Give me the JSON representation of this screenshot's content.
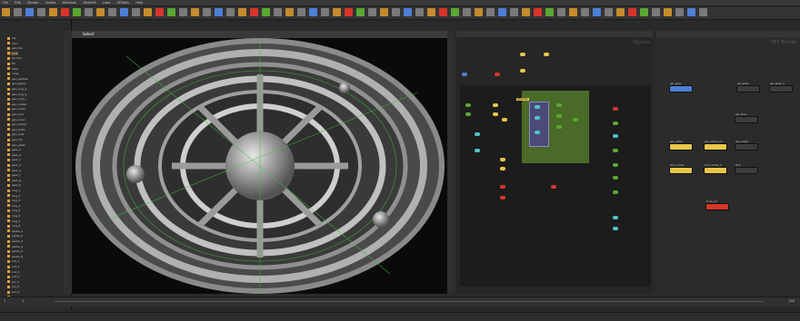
{
  "menu": {
    "items": [
      "File",
      "Edit",
      "Render",
      "Assets",
      "Windows",
      "Redshift",
      "Labs",
      "SDTools",
      "Help"
    ]
  },
  "viewport": {
    "mode_label": "Select",
    "tab": "obj"
  },
  "scene_tree": {
    "items": [
      "obj",
      "cam",
      "geo_tire",
      "light",
      "ground",
      "fill",
      "tube",
      "rings",
      "geo_spokes",
      "geo_gears",
      "geo_ring_a",
      "geo_ring_b",
      "geo_ring_c",
      "geo_center",
      "geo_outer",
      "geo_mid",
      "geo_inner",
      "geo_frame",
      "geo_bolts",
      "geo_axle",
      "geo_rim",
      "geo_plate",
      "gear_a",
      "gear_b",
      "gear_c",
      "gear_d",
      "gear_e",
      "gear_f",
      "gear_g",
      "gear_h",
      "ring_1",
      "ring_2",
      "ring_3",
      "ring_4",
      "ring_5",
      "ring_6",
      "ring_7",
      "ring_8",
      "spoke_1",
      "spoke_2",
      "spoke_3",
      "spoke_4",
      "spoke_5",
      "spoke_6",
      "nut_1",
      "nut_2",
      "nut_3",
      "nut_4",
      "pin_1",
      "pin_2",
      "pin_3",
      "pin_4"
    ]
  },
  "network": {
    "title": "Objects",
    "labels": [
      "SPheres2",
      "geo_shape"
    ]
  },
  "vex": {
    "title": "VEX Builder",
    "nodes": [
      "geo_glass",
      "geo_green",
      "geo_green_2",
      "geo_block",
      "geo_yellow",
      "geo_simple_red",
      "geo_simple",
      "bone_simple",
      "bone_simple_b",
      "bone_red",
      "fill_b"
    ]
  },
  "colors": {
    "yellow": "#e8c64b",
    "green": "#5aa832",
    "red": "#d8342a",
    "blue": "#4d7fd6",
    "cyan": "#4fc3c9",
    "node_bg": "#3c3c3c",
    "panel_green": "#4a6a28",
    "panel_purple": "#4b4a78"
  },
  "timeline": {
    "start": "1",
    "end": "240",
    "current": "1"
  }
}
